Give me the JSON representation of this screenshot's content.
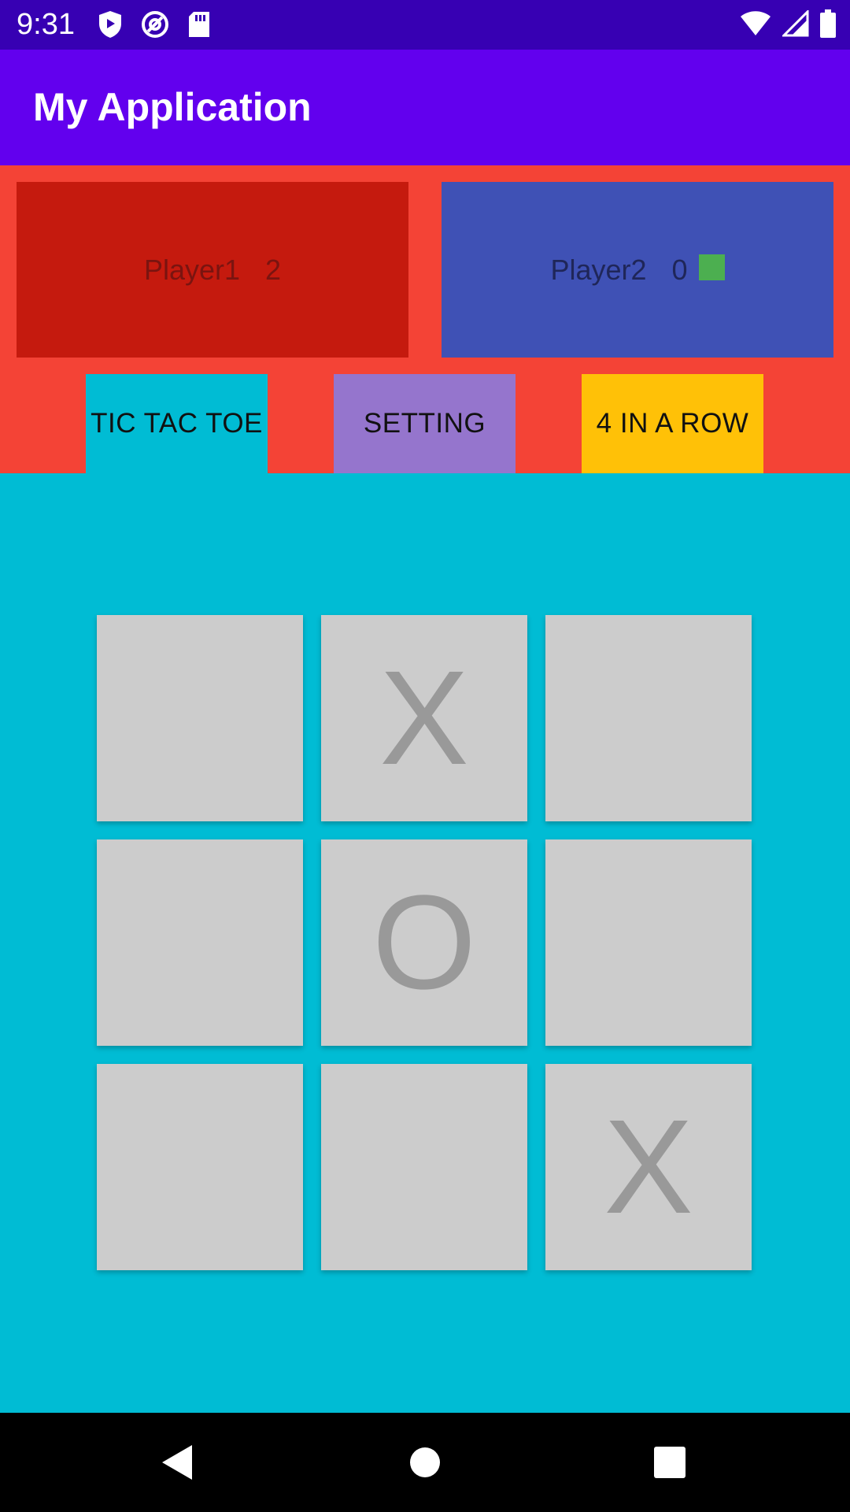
{
  "status_bar": {
    "time": "9:31",
    "left_icons": [
      "shield-icon",
      "at-icon",
      "sd-card-icon"
    ],
    "right_icons": [
      "wifi-icon",
      "signal-icon",
      "battery-icon"
    ]
  },
  "app_bar": {
    "title": "My Application",
    "color": "#6200EE"
  },
  "players": [
    {
      "name": "Player1",
      "score": "2",
      "color": "#C51A0E"
    },
    {
      "name": "Player2",
      "score": "0",
      "color": "#3F51B5",
      "indicator_color": "#4CAF50"
    }
  ],
  "tabs": [
    {
      "label": "TIC TAC TOE",
      "selected": true,
      "color": "#00BCD4"
    },
    {
      "label": "SETTING",
      "selected": false,
      "color": "#9575CD"
    },
    {
      "label": "4 IN A ROW",
      "selected": false,
      "color": "#FFC107"
    }
  ],
  "board": {
    "cells": [
      "",
      "X",
      "",
      "",
      "O",
      "",
      "",
      "",
      "X"
    ]
  },
  "nav_bar": {
    "buttons": [
      "back-icon",
      "home-icon",
      "recents-icon"
    ]
  }
}
